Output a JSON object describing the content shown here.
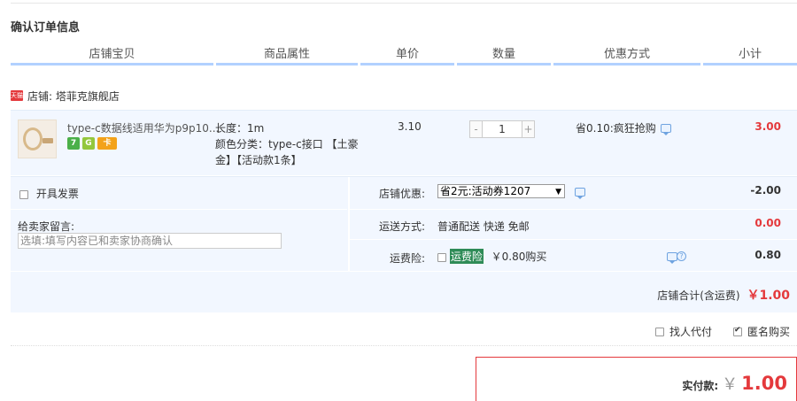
{
  "section_title": "确认订单信息",
  "columns": [
    "店铺宝贝",
    "商品属性",
    "单价",
    "数量",
    "优惠方式",
    "小计"
  ],
  "shop": {
    "badge": "天猫",
    "label": "店铺: 塔菲克旗舰店"
  },
  "item": {
    "name": "type-c数据线适用华为p9p10...",
    "tags": [
      "7",
      "G",
      "卡"
    ],
    "attr_length": "长度：1m",
    "attr_color_1": "颜色分类：type-c接口 【土豪",
    "attr_color_2": "金】【活动款1条】",
    "price": "3.10",
    "qty_minus": "-",
    "qty": "1",
    "qty_plus": "+",
    "promo": "省0.10:疯狂抢购",
    "subtotal": "3.00"
  },
  "invoice": {
    "label": "开具发票",
    "checked": false
  },
  "shop_discount": {
    "label": "店铺优惠:",
    "selected": "省2元:活动券1207",
    "value": "-2.00"
  },
  "message": {
    "label": "给卖家留言:",
    "placeholder": "选填:填写内容已和卖家协商确认"
  },
  "shipping": {
    "label": "运送方式:",
    "value": "普通配送 快递 免邮",
    "cost": "0.00"
  },
  "insurance": {
    "label": "运费险:",
    "tag": "运费险",
    "price": "￥0.80购买",
    "value": "0.80",
    "checked": false
  },
  "shop_total": {
    "label": "店铺合计(含运费)",
    "amount": "￥1.00"
  },
  "options": [
    {
      "label": "找人代付",
      "checked": false
    },
    {
      "label": "匿名购买",
      "checked": true
    }
  ],
  "payment": {
    "label": "实付款:",
    "yen": "￥",
    "amount": "1.00"
  },
  "colors": {
    "accent_red": "#e4393c",
    "header_blue": "#b2d1ff",
    "panel_bg": "#f2f7ff"
  }
}
